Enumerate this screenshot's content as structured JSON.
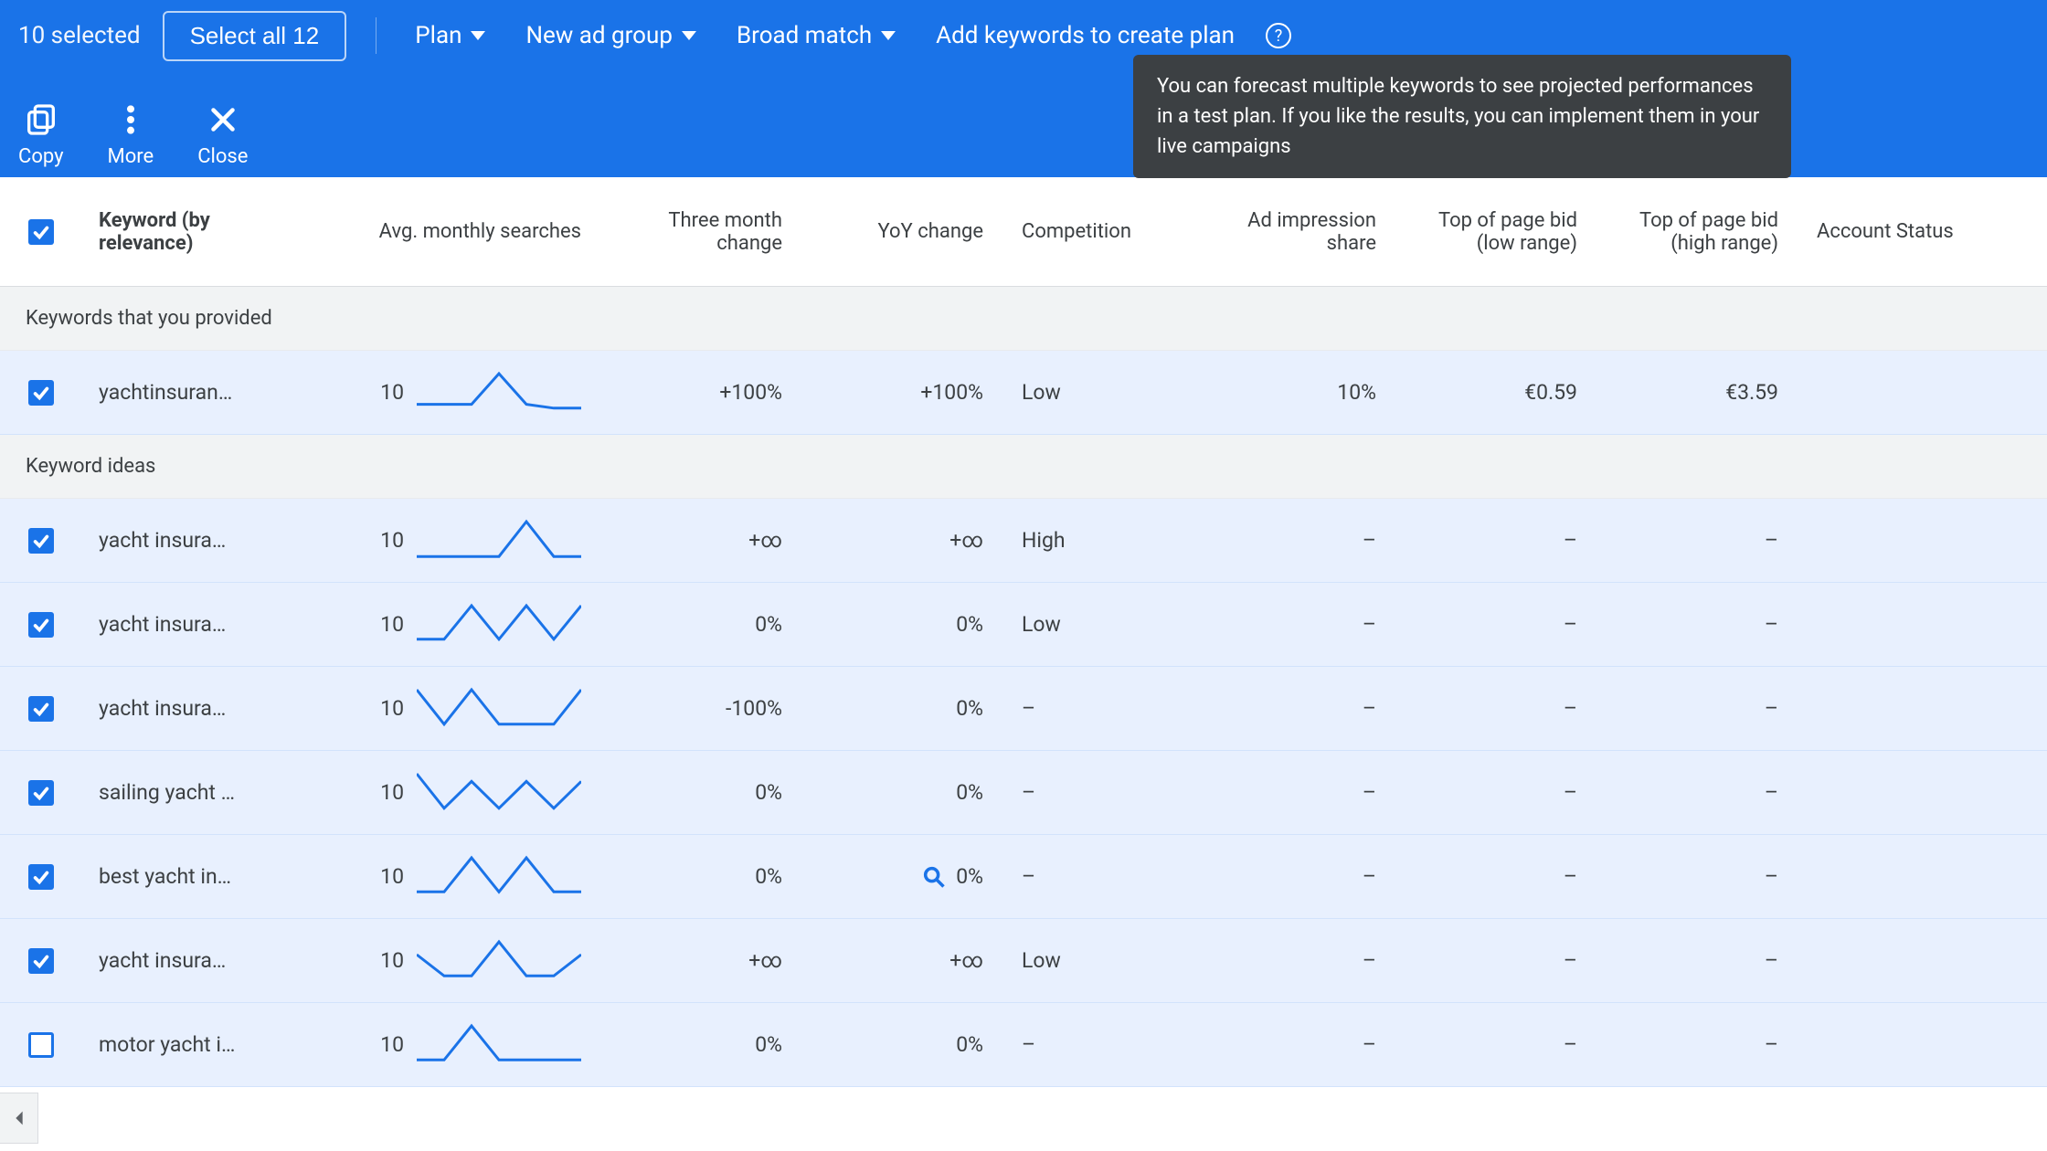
{
  "toolbar": {
    "selected_count": "10 selected",
    "select_all": "Select all 12",
    "plan": "Plan",
    "new_ad_group": "New ad group",
    "broad_match": "Broad match",
    "add_keywords": "Add keywords to create plan"
  },
  "actions": {
    "copy": "Copy",
    "more": "More",
    "close": "Close"
  },
  "tooltip": "You can forecast multiple keywords to see projected performances in a test plan. If you like the results, you can implement them in your live campaigns",
  "columns": {
    "keyword": "Keyword (by relevance)",
    "avg_searches": "Avg. monthly searches",
    "three_month": "Three month change",
    "yoy": "YoY change",
    "competition": "Competition",
    "impression_share": "Ad impression share",
    "bid_low": "Top of page bid (low range)",
    "bid_high": "Top of page bid (high range)",
    "account_status": "Account Status"
  },
  "sections": {
    "provided": "Keywords that you provided",
    "ideas": "Keyword ideas"
  },
  "rows_provided": [
    {
      "keyword": "yachtinsuran…",
      "searches": "10",
      "spark": [
        10,
        10,
        10,
        50,
        10,
        5,
        5
      ],
      "three_month": "+100%",
      "yoy": "+100%",
      "competition": "Low",
      "impression_share": "10%",
      "bid_low": "€0.59",
      "bid_high": "€3.59",
      "mag": false
    }
  ],
  "rows_ideas": [
    {
      "keyword": "yacht insura…",
      "searches": "10",
      "spark": [
        5,
        5,
        5,
        5,
        55,
        5,
        5
      ],
      "three_month": "+∞",
      "yoy": "+∞",
      "competition": "High",
      "impression_share": "–",
      "bid_low": "–",
      "bid_high": "–",
      "mag": false
    },
    {
      "keyword": "yacht insura…",
      "searches": "10",
      "spark": [
        5,
        5,
        40,
        5,
        40,
        5,
        40
      ],
      "three_month": "0%",
      "yoy": "0%",
      "competition": "Low",
      "impression_share": "–",
      "bid_low": "–",
      "bid_high": "–",
      "mag": false
    },
    {
      "keyword": "yacht insura…",
      "searches": "10",
      "spark": [
        50,
        5,
        50,
        5,
        5,
        5,
        50
      ],
      "three_month": "-100%",
      "yoy": "0%",
      "competition": "–",
      "impression_share": "–",
      "bid_low": "–",
      "bid_high": "–",
      "mag": false
    },
    {
      "keyword": "sailing yacht …",
      "searches": "10",
      "spark": [
        50,
        5,
        40,
        5,
        40,
        5,
        40
      ],
      "three_month": "0%",
      "yoy": "0%",
      "competition": "–",
      "impression_share": "–",
      "bid_low": "–",
      "bid_high": "–",
      "mag": false
    },
    {
      "keyword": "best yacht in…",
      "searches": "10",
      "spark": [
        5,
        5,
        45,
        5,
        45,
        5,
        5
      ],
      "three_month": "0%",
      "yoy": "0%",
      "competition": "–",
      "impression_share": "–",
      "bid_low": "–",
      "bid_high": "–",
      "mag": true
    },
    {
      "keyword": "yacht insura…",
      "searches": "10",
      "spark": [
        30,
        5,
        5,
        45,
        5,
        5,
        30
      ],
      "three_month": "+∞",
      "yoy": "+∞",
      "competition": "Low",
      "impression_share": "–",
      "bid_low": "–",
      "bid_high": "–",
      "mag": false
    },
    {
      "keyword": "motor yacht i…",
      "searches": "10",
      "spark": [
        5,
        5,
        45,
        5,
        5,
        5,
        5
      ],
      "three_month": "0%",
      "yoy": "0%",
      "competition": "–",
      "impression_share": "–",
      "bid_low": "–",
      "bid_high": "–",
      "mag": false
    }
  ]
}
